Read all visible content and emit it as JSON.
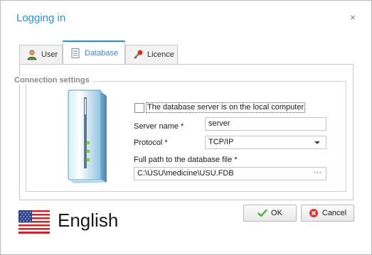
{
  "window": {
    "title": "Logging in",
    "close_glyph": "×"
  },
  "tabs": [
    {
      "label": "User",
      "icon": "user-icon"
    },
    {
      "label": "Database",
      "icon": "database-document-icon",
      "active": true
    },
    {
      "label": "Licence",
      "icon": "key-icon"
    }
  ],
  "connection": {
    "group_title": "Connection settings",
    "local_server_label": "The database server is on the local computer",
    "local_server_checked": false,
    "server_name_label": "Server name *",
    "server_name_value": "server",
    "protocol_label": "Protocol *",
    "protocol_value": "TCP/IP",
    "path_label": "Full path to the database file *",
    "path_value": "C:\\USU\\medicine\\USU.FDB",
    "browse_glyph": "···"
  },
  "language": {
    "name": "English",
    "flag_icon": "us-flag-icon"
  },
  "buttons": {
    "ok_label": "OK",
    "cancel_label": "Cancel"
  },
  "colors": {
    "accent": "#2a8fd0",
    "ok_check": "#4caf3a",
    "cancel_x": "#d9342b"
  }
}
